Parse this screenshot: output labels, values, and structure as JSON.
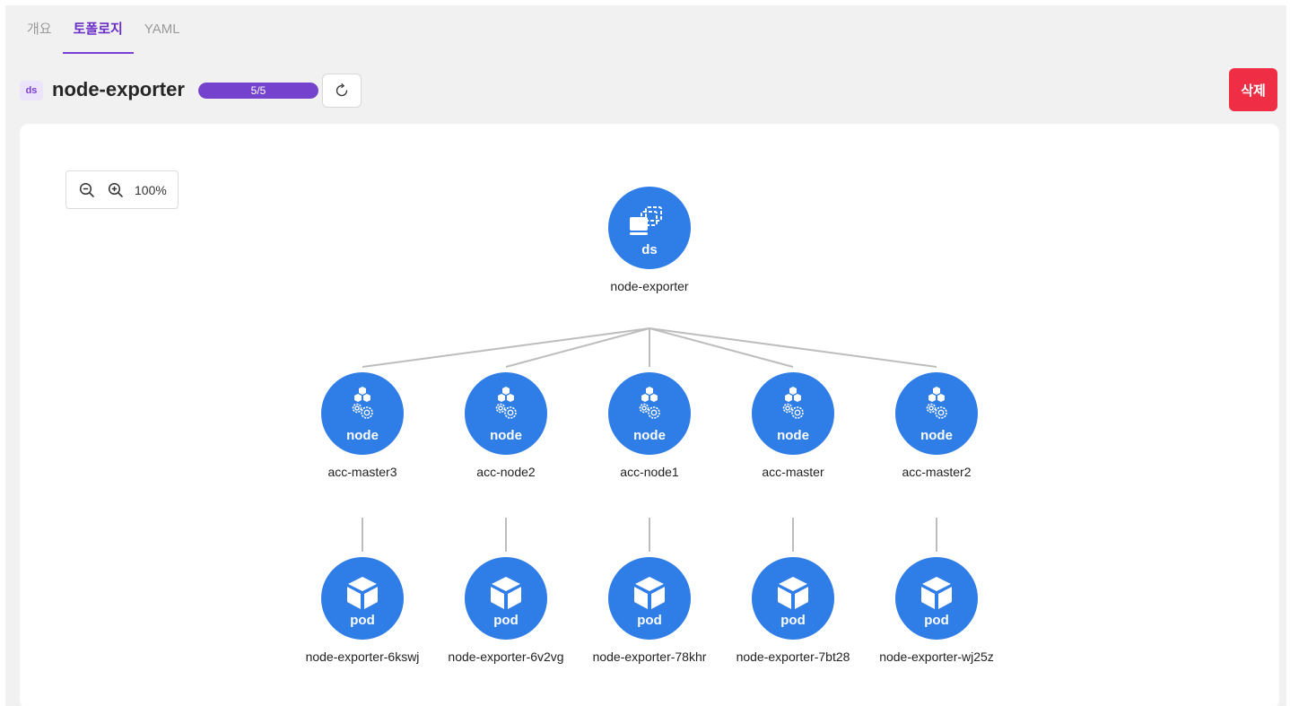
{
  "tabs": [
    {
      "label": "개요",
      "active": false
    },
    {
      "label": "토폴로지",
      "active": true
    },
    {
      "label": "YAML",
      "active": false
    }
  ],
  "resource": {
    "kind_badge": "ds",
    "name": "node-exporter",
    "ready_text": "5/5",
    "ready_fraction": 1.0
  },
  "actions": {
    "refresh_icon": "refresh-icon",
    "delete_label": "삭제"
  },
  "zoom": {
    "zoom_out_icon": "zoom-out-icon",
    "zoom_in_icon": "zoom-in-icon",
    "level": "100%"
  },
  "topology": {
    "root": {
      "kind": "ds",
      "name": "node-exporter",
      "icon": "daemonset-icon"
    },
    "nodes": [
      {
        "kind": "node",
        "name": "acc-master3",
        "icon": "node-icon",
        "pod": {
          "kind": "pod",
          "name": "node-exporter-6kswj",
          "icon": "pod-icon"
        }
      },
      {
        "kind": "node",
        "name": "acc-node2",
        "icon": "node-icon",
        "pod": {
          "kind": "pod",
          "name": "node-exporter-6v2vg",
          "icon": "pod-icon"
        }
      },
      {
        "kind": "node",
        "name": "acc-node1",
        "icon": "node-icon",
        "pod": {
          "kind": "pod",
          "name": "node-exporter-78khr",
          "icon": "pod-icon"
        }
      },
      {
        "kind": "node",
        "name": "acc-master",
        "icon": "node-icon",
        "pod": {
          "kind": "pod",
          "name": "node-exporter-7bt28",
          "icon": "pod-icon"
        }
      },
      {
        "kind": "node",
        "name": "acc-master2",
        "icon": "node-icon",
        "pod": {
          "kind": "pod",
          "name": "node-exporter-wj25z",
          "icon": "pod-icon"
        }
      }
    ]
  },
  "colors": {
    "accent": "#7b3fd9",
    "node_fill": "#2f7de6",
    "edge": "#bdbdbd",
    "danger": "#ef2e45"
  }
}
